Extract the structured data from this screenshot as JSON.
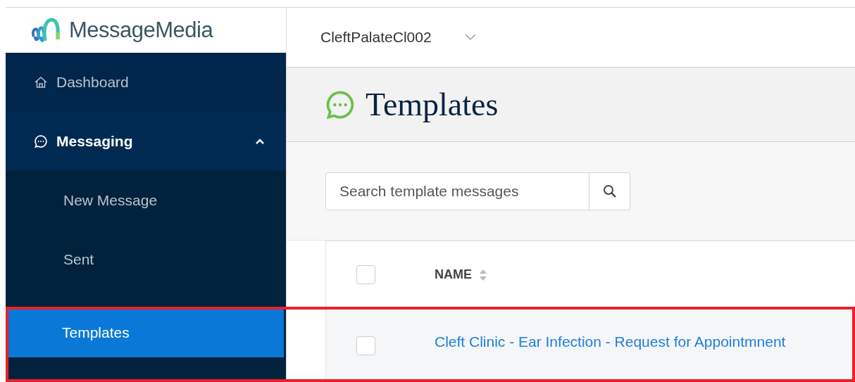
{
  "logo": {
    "text": "MessageMedia"
  },
  "account": {
    "name": "CleftPalateCl002"
  },
  "sidebar": {
    "items": [
      {
        "label": "Dashboard",
        "kind": "home",
        "selected": false
      },
      {
        "label": "Messaging",
        "kind": "chat",
        "selected": false,
        "expanded": true,
        "children": [
          {
            "label": "New Message",
            "selected": false
          },
          {
            "label": "Sent",
            "selected": false
          },
          {
            "label": "Templates",
            "selected": true
          }
        ]
      }
    ]
  },
  "page": {
    "title": "Templates"
  },
  "search": {
    "placeholder": "Search template messages"
  },
  "table": {
    "columns": [
      {
        "label": "NAME",
        "sortable": true
      }
    ],
    "rows": [
      {
        "name": "Cleft Clinic - Ear Infection - Request for Appointmnent",
        "checked": false
      }
    ],
    "header_checked": false
  }
}
